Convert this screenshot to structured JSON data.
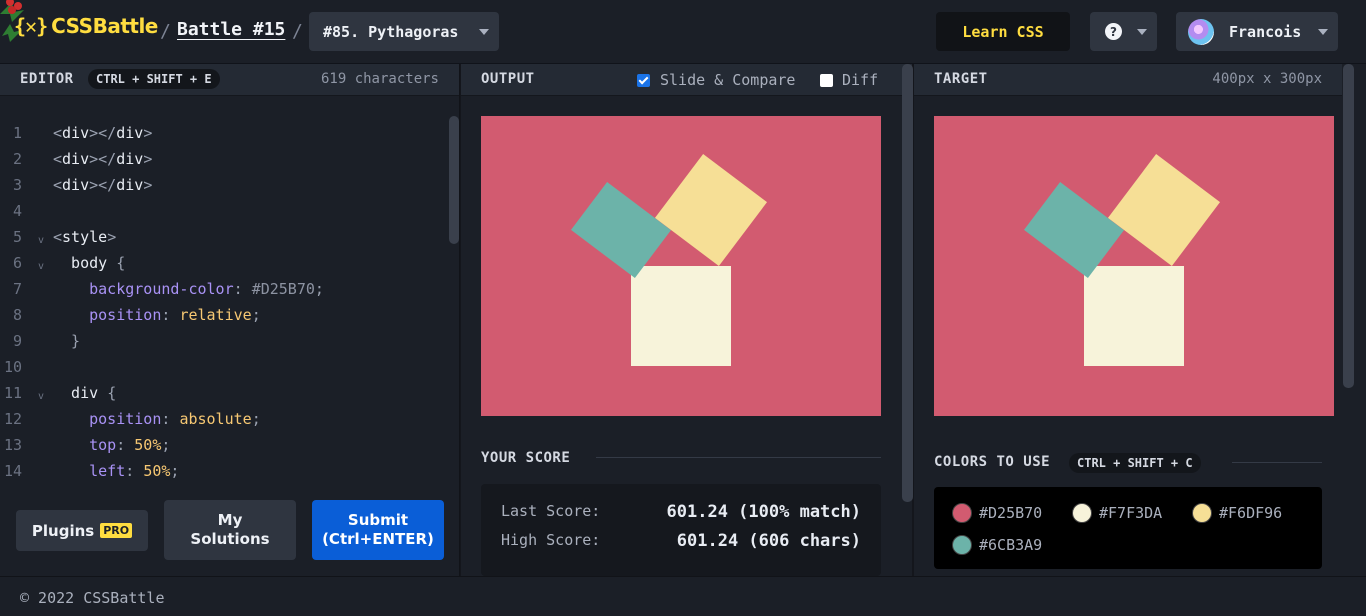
{
  "header": {
    "logo_mark": "{✕}",
    "logo_text": "CSSBattle",
    "separator": "/",
    "battle_link": "Battle #15",
    "target_select": "#85. Pythagoras",
    "learn_css": "Learn CSS",
    "help_icon": "?",
    "user_name": "Francois"
  },
  "editor": {
    "title": "EDITOR",
    "shortcut": "CTRL + SHIFT + E",
    "char_count": "619 characters",
    "lines": [
      {
        "n": "1",
        "text": "<div></div>"
      },
      {
        "n": "2",
        "text": "<div></div>"
      },
      {
        "n": "3",
        "text": "<div></div>"
      },
      {
        "n": "4",
        "text": ""
      },
      {
        "n": "5",
        "text": "<style>"
      },
      {
        "n": "6",
        "text": "  body {"
      },
      {
        "n": "7",
        "text": "    background-color: #D25B70;"
      },
      {
        "n": "8",
        "text": "    position: relative;"
      },
      {
        "n": "9",
        "text": "  }"
      },
      {
        "n": "10",
        "text": ""
      },
      {
        "n": "11",
        "text": "  div {"
      },
      {
        "n": "12",
        "text": "    position: absolute;"
      },
      {
        "n": "13",
        "text": "    top: 50%;"
      },
      {
        "n": "14",
        "text": "    left: 50%;"
      }
    ],
    "plugins_label": "Plugins",
    "pro_badge": "PRO",
    "my_solutions_label": "My\nSolutions",
    "submit_label": "Submit\n(Ctrl+ENTER)"
  },
  "output": {
    "title": "OUTPUT",
    "slide_compare_label": "Slide & Compare",
    "slide_compare_checked": true,
    "diff_label": "Diff",
    "diff_checked": false
  },
  "score": {
    "title": "YOUR SCORE",
    "last_label": "Last Score:",
    "last_value": "601.24 (100% match)",
    "high_label": "High Score:",
    "high_value": "601.24 (606 chars)"
  },
  "target": {
    "title": "TARGET",
    "size": "400px x 300px",
    "colors_title": "COLORS TO USE",
    "colors_shortcut": "CTRL + SHIFT + C",
    "colors": [
      {
        "hex": "#D25B70"
      },
      {
        "hex": "#F7F3DA"
      },
      {
        "hex": "#F6DF96"
      },
      {
        "hex": "#6CB3A9"
      }
    ]
  },
  "footer": {
    "copyright": "© 2022 CSSBattle"
  },
  "theme": {
    "accent_yellow": "#ffdd40",
    "submit_blue": "#0a5ed7"
  }
}
